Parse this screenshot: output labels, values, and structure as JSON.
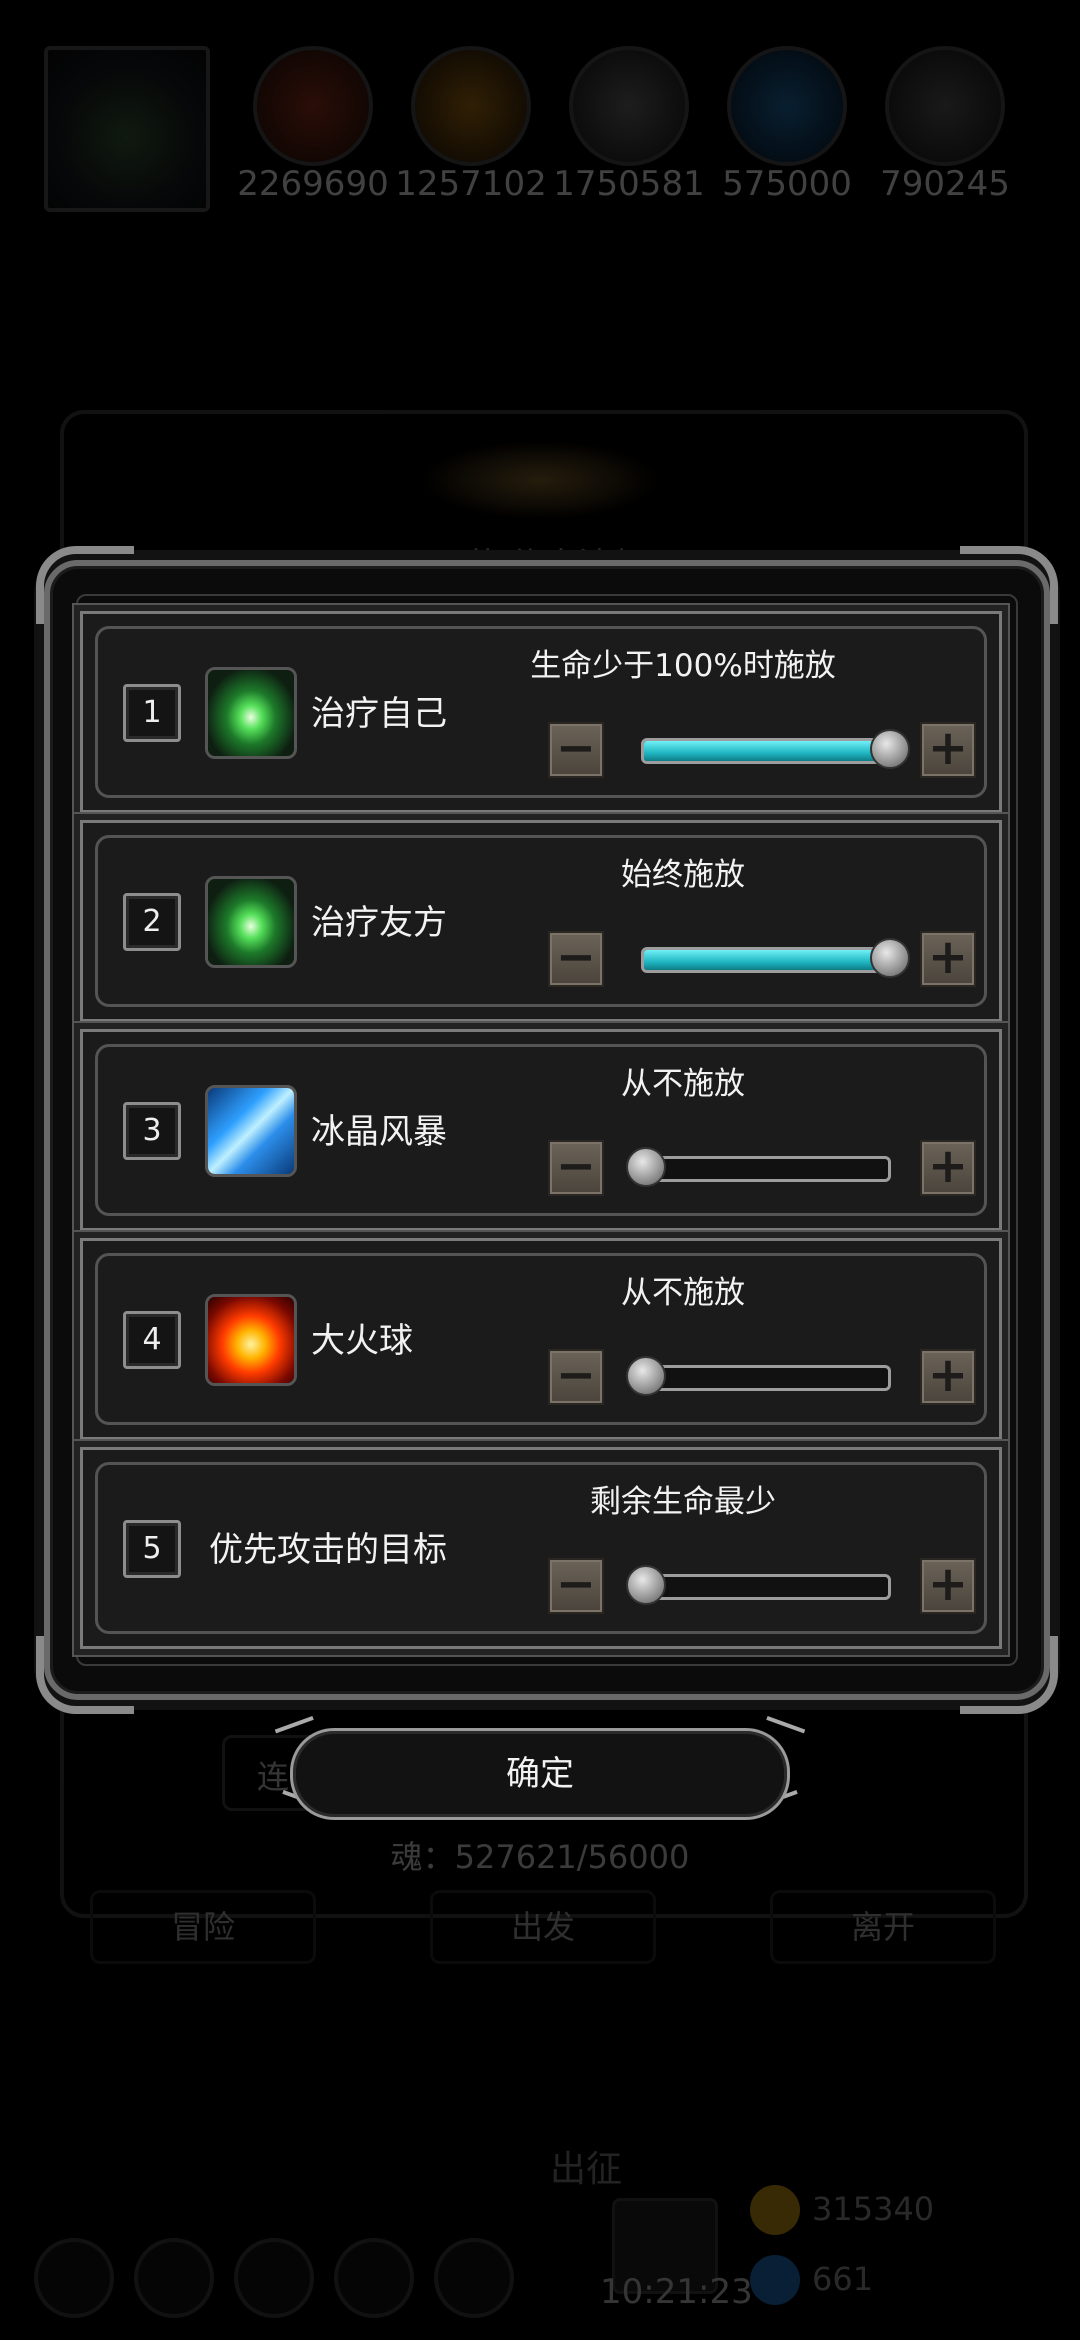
{
  "background": {
    "resources": [
      {
        "value": "2269690",
        "color": "#7a2a18"
      },
      {
        "value": "1257102",
        "color": "#8a5a10"
      },
      {
        "value": "1750581",
        "color": "#555555"
      },
      {
        "value": "575000",
        "color": "#1a5a8a"
      },
      {
        "value": "790245",
        "color": "#4a4a4a"
      }
    ],
    "title_partial": "753节 传奇法师",
    "left_button_partial": "连",
    "soul_text": "魂：527621/56000",
    "nav": [
      "冒险",
      "出发",
      "离开"
    ],
    "chuzheng_label": "出征",
    "gold_value": "315340",
    "gem_value": "661",
    "time": "10:21:23"
  },
  "dialog": {
    "rows": [
      {
        "index": "1",
        "icon": "heal-crystal-icon",
        "name": "治疗自己",
        "condition": "生命少于100%时施放",
        "level": 1.0
      },
      {
        "index": "2",
        "icon": "heal-crystal-icon",
        "name": "治疗友方",
        "condition": "始终施放",
        "level": 1.0
      },
      {
        "index": "3",
        "icon": "ice-storm-icon",
        "name": "冰晶风暴",
        "condition": "从不施放",
        "level": 0.0
      },
      {
        "index": "4",
        "icon": "fireball-icon",
        "name": "大火球",
        "condition": "从不施放",
        "level": 0.0
      },
      {
        "index": "5",
        "icon": "",
        "name": "优先攻击的目标",
        "condition": "剩余生命最少",
        "level": 0.0
      }
    ],
    "minus_label": "−",
    "plus_label": "+",
    "confirm_label": "确定"
  },
  "colors": {
    "slider_fill": "#1fb6c2",
    "frame": "#7a7a7a",
    "stepper": "#5a534a"
  }
}
